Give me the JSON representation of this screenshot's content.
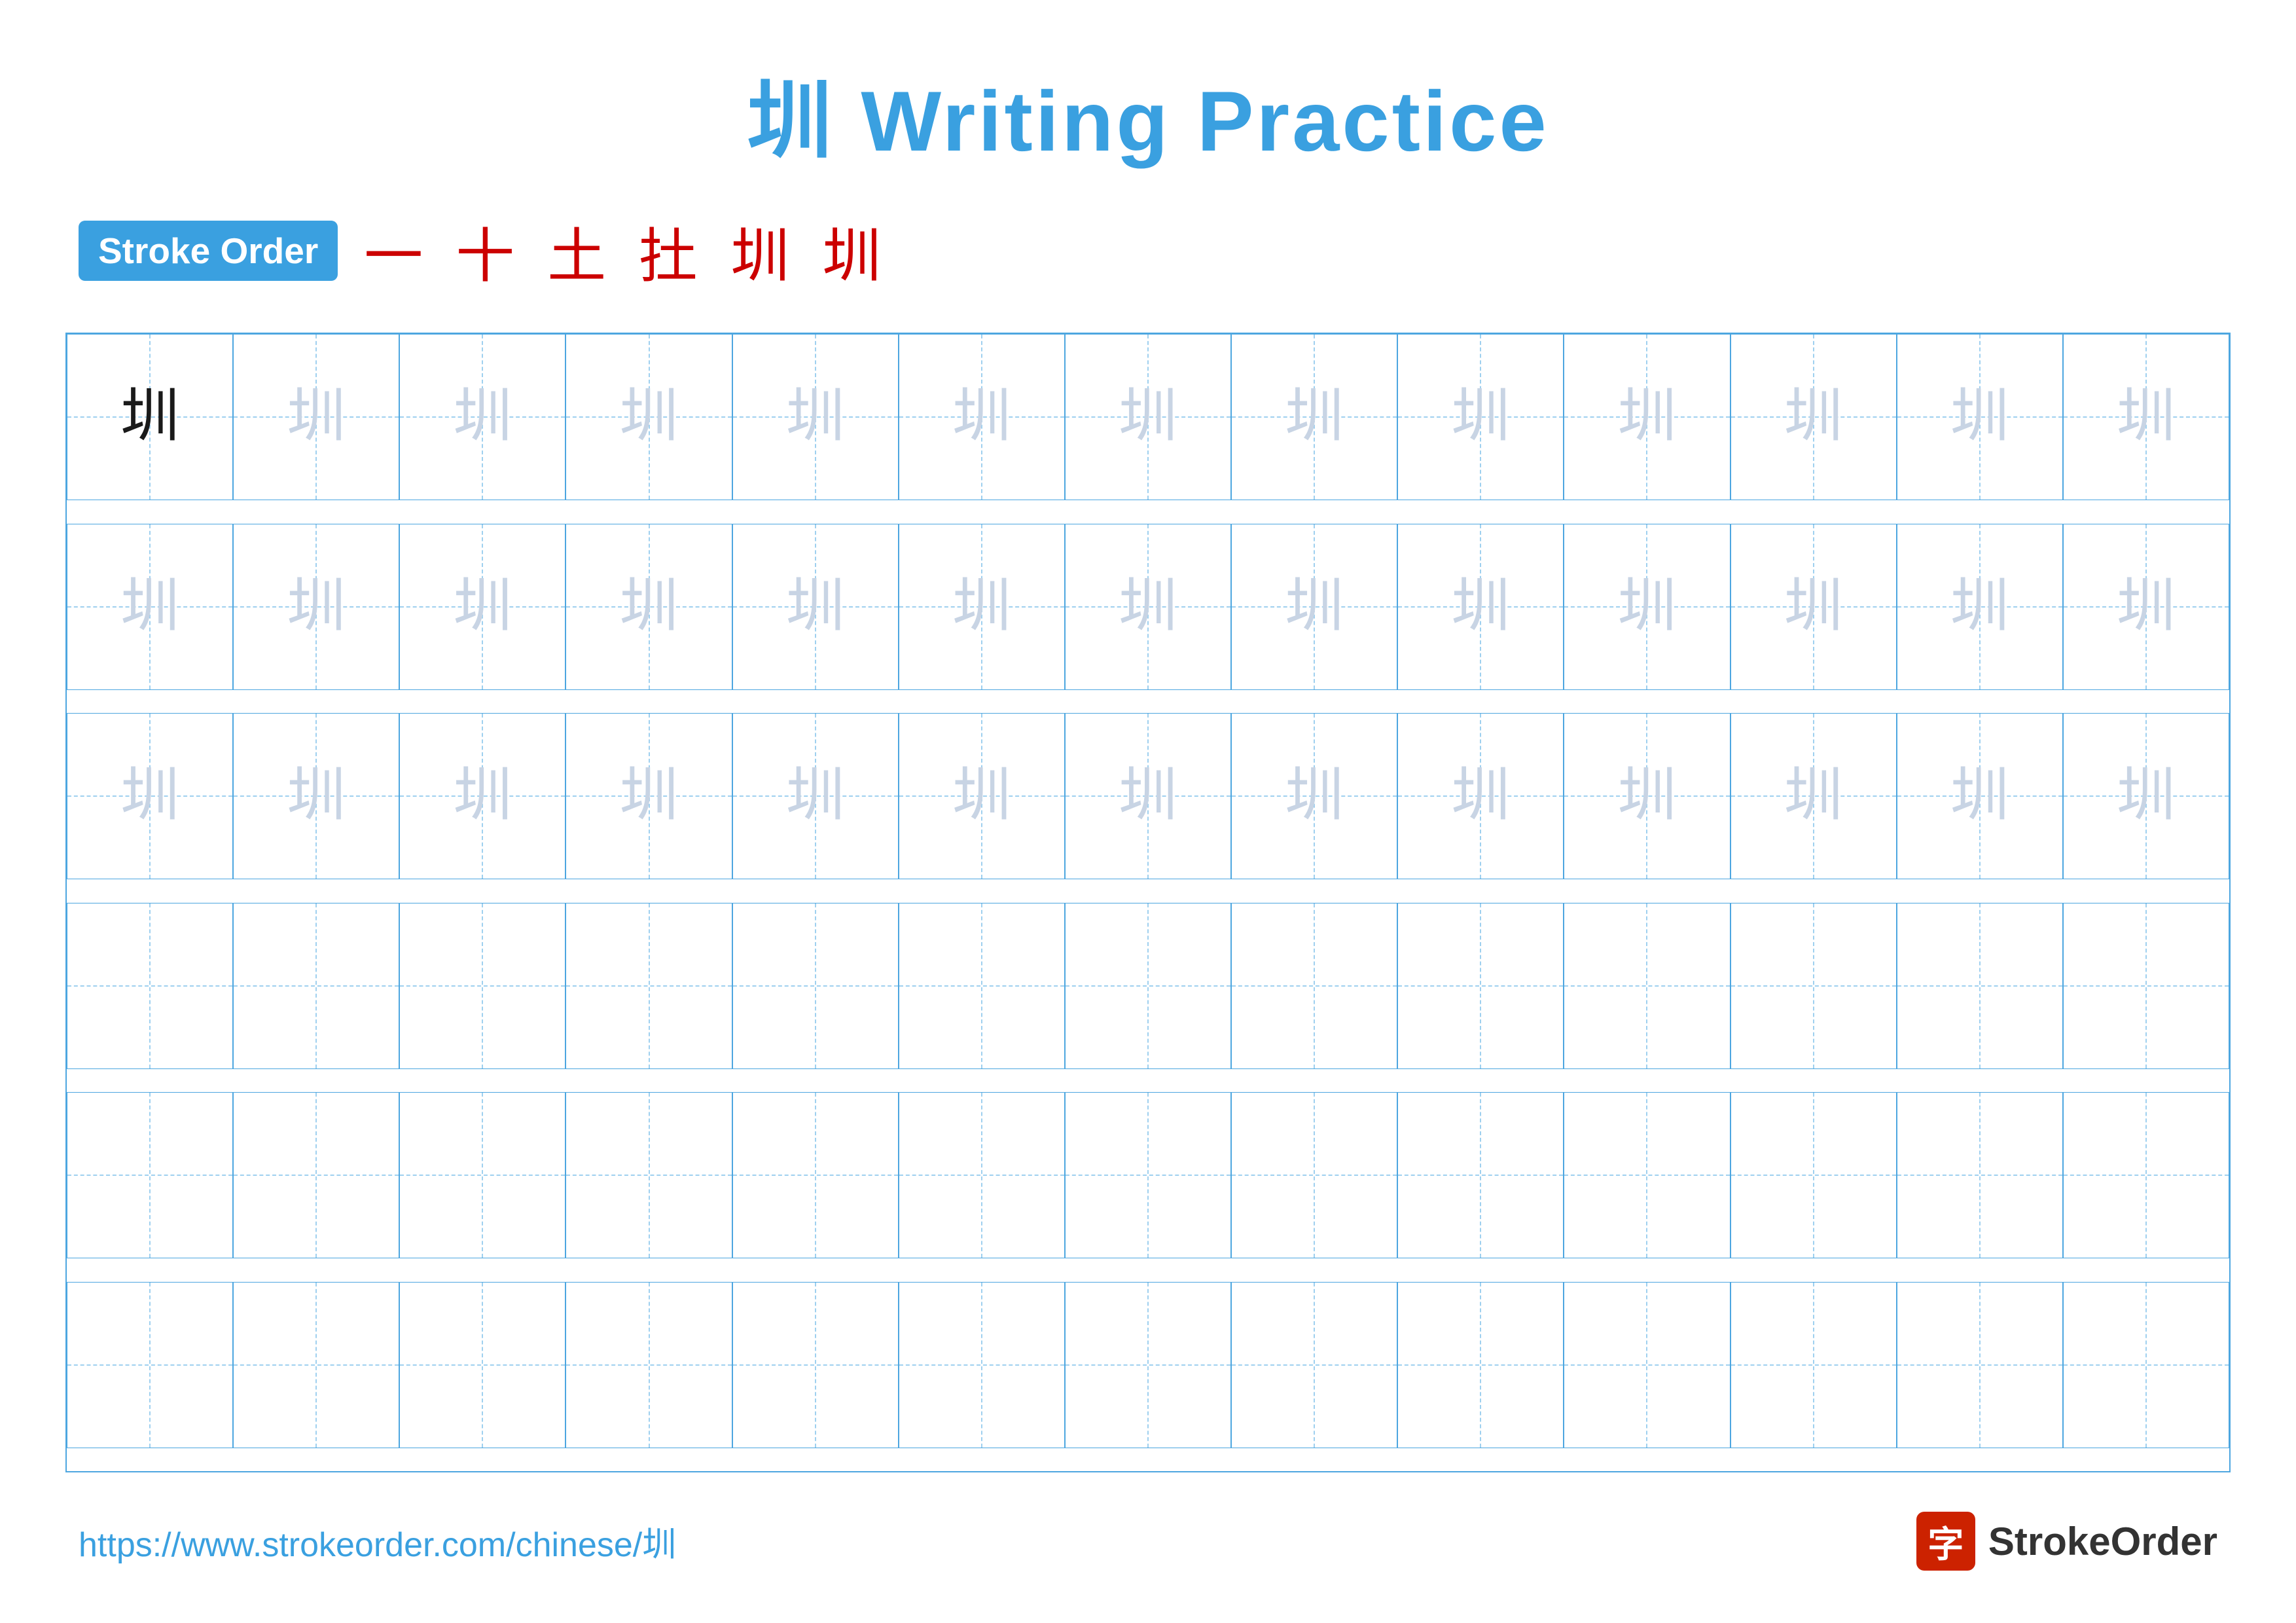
{
  "title": {
    "chinese": "圳",
    "english": "Writing Practice",
    "full": "圳 Writing Practice"
  },
  "stroke_order": {
    "badge_label": "Stroke Order",
    "steps": [
      "一",
      "十",
      "土",
      "扗",
      "圳",
      "圳"
    ]
  },
  "grid": {
    "rows": 6,
    "cols": 13,
    "character": "圳",
    "filled_rows": 3,
    "empty_rows": 3
  },
  "footer": {
    "url": "https://www.strokeorder.com/chinese/圳",
    "logo_text": "StrokeOrder",
    "logo_char": "字"
  }
}
